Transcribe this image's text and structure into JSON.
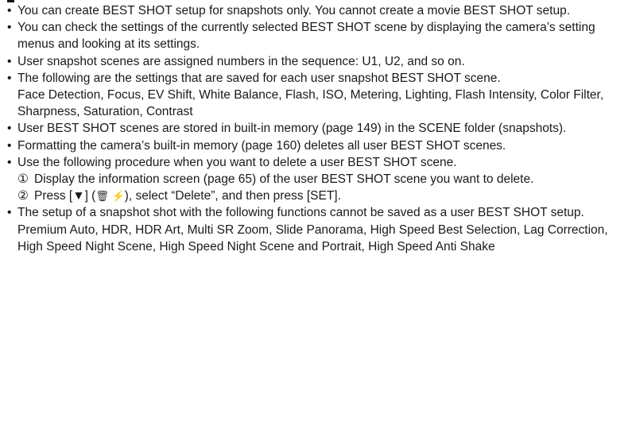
{
  "notes": [
    {
      "text": "You can create BEST SHOT setup for snapshots only. You cannot create a movie BEST SHOT setup."
    },
    {
      "text": "You can check the settings of the currently selected BEST SHOT scene by displaying the camera’s setting menus and looking at its settings."
    },
    {
      "text": "User snapshot scenes are assigned numbers in the sequence: U1, U2, and so on."
    },
    {
      "text": "The following are the settings that are saved for each user snapshot BEST SHOT scene.",
      "detail": "Face Detection, Focus, EV Shift, White Balance, Flash, ISO, Metering, Lighting, Flash Intensity, Color Filter, Sharpness, Saturation, Contrast"
    },
    {
      "text": "User BEST SHOT scenes are stored in built-in memory (page 149) in the SCENE folder (snapshots)."
    },
    {
      "text": "Formatting the camera’s built-in memory (page 160) deletes all user BEST SHOT scenes."
    },
    {
      "text": "Use the following procedure when you want to delete a user BEST SHOT scene.",
      "steps": [
        {
          "num": "①",
          "text": "Display the information screen (page 65) of the user BEST SHOT scene you want to delete."
        },
        {
          "num": "②",
          "pre": "Press [▼] (",
          "icons": "🗑 ⚡",
          "post": "), select “Delete”, and then press [SET]."
        }
      ]
    },
    {
      "text": "The setup of a snapshot shot with the following functions cannot be saved as a user BEST SHOT setup.",
      "detail": "Premium Auto, HDR, HDR Art, Multi SR Zoom, Slide Panorama, High Speed Best Selection, Lag Correction, High Speed Night Scene, High Speed Night Scene and Portrait, High Speed Anti Shake"
    }
  ],
  "bullet": "•"
}
